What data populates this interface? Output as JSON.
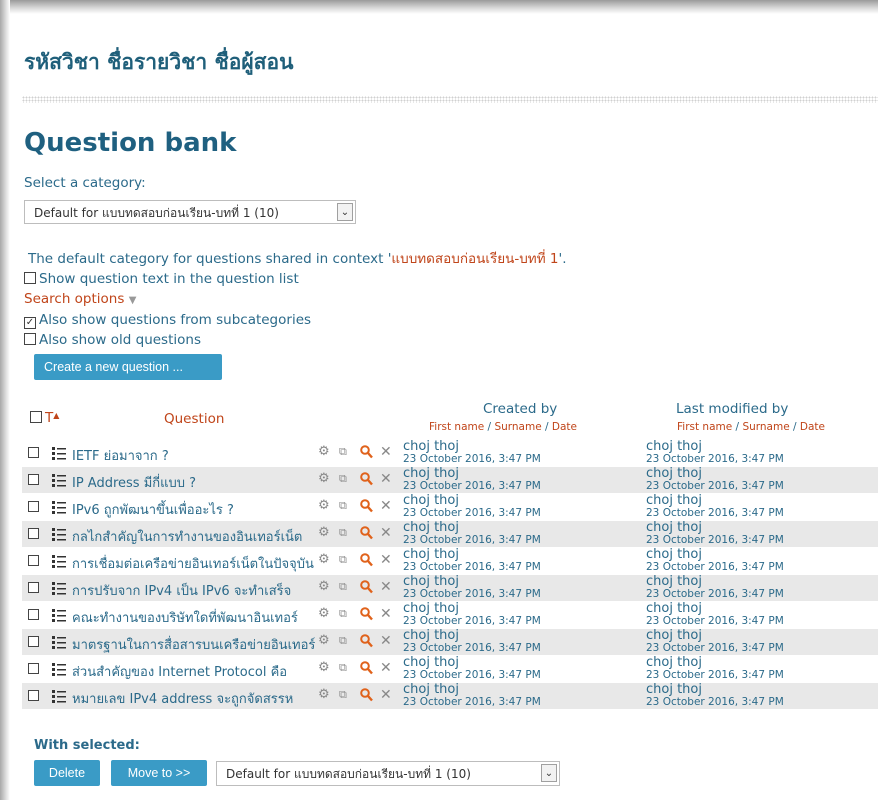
{
  "course": {
    "title": "รหัสวิชา ชื่อรายวิชา ชื่อผู้สอน"
  },
  "page": {
    "heading": "Question bank"
  },
  "category": {
    "label": "Select a category:",
    "selected": "Default for แบบทดสอบก่อนเรียน-บทที่ 1 (10)",
    "context_prefix": "The default category for questions shared in context '",
    "context_name": "แบบทดสอบก่อนเรียน-บทที่ 1",
    "context_suffix": "'."
  },
  "options": {
    "show_text": "Show question text in the question list",
    "search_options": "Search options",
    "subcategories": "Also show questions from subcategories",
    "subcategories_checked": true,
    "old_questions": "Also show old questions"
  },
  "buttons": {
    "create": "Create a new question ...",
    "delete": "Delete",
    "move": "Move to >>"
  },
  "table": {
    "col_type": "T",
    "col_type_sort": "▲",
    "col_question": "Question",
    "col_created": "Created by",
    "col_modified": "Last modified by",
    "sub_first": "First name",
    "sub_sep": " / ",
    "sub_surname": "Surname",
    "sub_date": "Date"
  },
  "rows": [
    {
      "name": "IETF ย่อมาจาก ?",
      "creator": "choj thoj",
      "created": "23 October 2016, 3:47 PM",
      "modifier": "choj thoj",
      "modified": "23 October 2016, 3:47 PM"
    },
    {
      "name": "IP Address มีกี่แบบ ?",
      "creator": "choj thoj",
      "created": "23 October 2016, 3:47 PM",
      "modifier": "choj thoj",
      "modified": "23 October 2016, 3:47 PM"
    },
    {
      "name": "IPv6 ถูกพัฒนาขึ้นเพื่ออะไร ?",
      "creator": "choj thoj",
      "created": "23 October 2016, 3:47 PM",
      "modifier": "choj thoj",
      "modified": "23 October 2016, 3:47 PM"
    },
    {
      "name": "กลไกสำคัญในการทำงานของอินเทอร์เน็ต",
      "creator": "choj thoj",
      "created": "23 October 2016, 3:47 PM",
      "modifier": "choj thoj",
      "modified": "23 October 2016, 3:47 PM"
    },
    {
      "name": "การเชื่อมต่อเครือข่ายอินเทอร์เน็ตในปัจจุบัน",
      "creator": "choj thoj",
      "created": "23 October 2016, 3:47 PM",
      "modifier": "choj thoj",
      "modified": "23 October 2016, 3:47 PM"
    },
    {
      "name": "การปรับจาก IPv4 เป็น IPv6 จะทำเสร็จ",
      "creator": "choj thoj",
      "created": "23 October 2016, 3:47 PM",
      "modifier": "choj thoj",
      "modified": "23 October 2016, 3:47 PM"
    },
    {
      "name": "คณะทำงานของบริษัทใดที่พัฒนาอินเทอร์",
      "creator": "choj thoj",
      "created": "23 October 2016, 3:47 PM",
      "modifier": "choj thoj",
      "modified": "23 October 2016, 3:47 PM"
    },
    {
      "name": "มาตรฐานในการสื่อสารบนเครือข่ายอินเทอร์",
      "creator": "choj thoj",
      "created": "23 October 2016, 3:47 PM",
      "modifier": "choj thoj",
      "modified": "23 October 2016, 3:47 PM"
    },
    {
      "name": "ส่วนสำคัญของ Internet Protocol คือ",
      "creator": "choj thoj",
      "created": "23 October 2016, 3:47 PM",
      "modifier": "choj thoj",
      "modified": "23 October 2016, 3:47 PM"
    },
    {
      "name": "หมายเลข IPv4 address จะถูกจัดสรรห",
      "creator": "choj thoj",
      "created": "23 October 2016, 3:47 PM",
      "modifier": "choj thoj",
      "modified": "23 October 2016, 3:47 PM"
    }
  ],
  "with_selected": {
    "label": "With selected:",
    "target": "Default for แบบทดสอบก่อนเรียน-บทที่ 1 (10)"
  },
  "colors": {
    "link": "#2b6a8a",
    "accent": "#c0451a",
    "button": "#3a9bc6",
    "row_shade": "#e8e8e8"
  },
  "icons": [
    "question-type-icon",
    "gear-icon",
    "copy-icon",
    "preview-icon",
    "delete-icon",
    "chevron-down-icon",
    "sort-up-icon"
  ]
}
